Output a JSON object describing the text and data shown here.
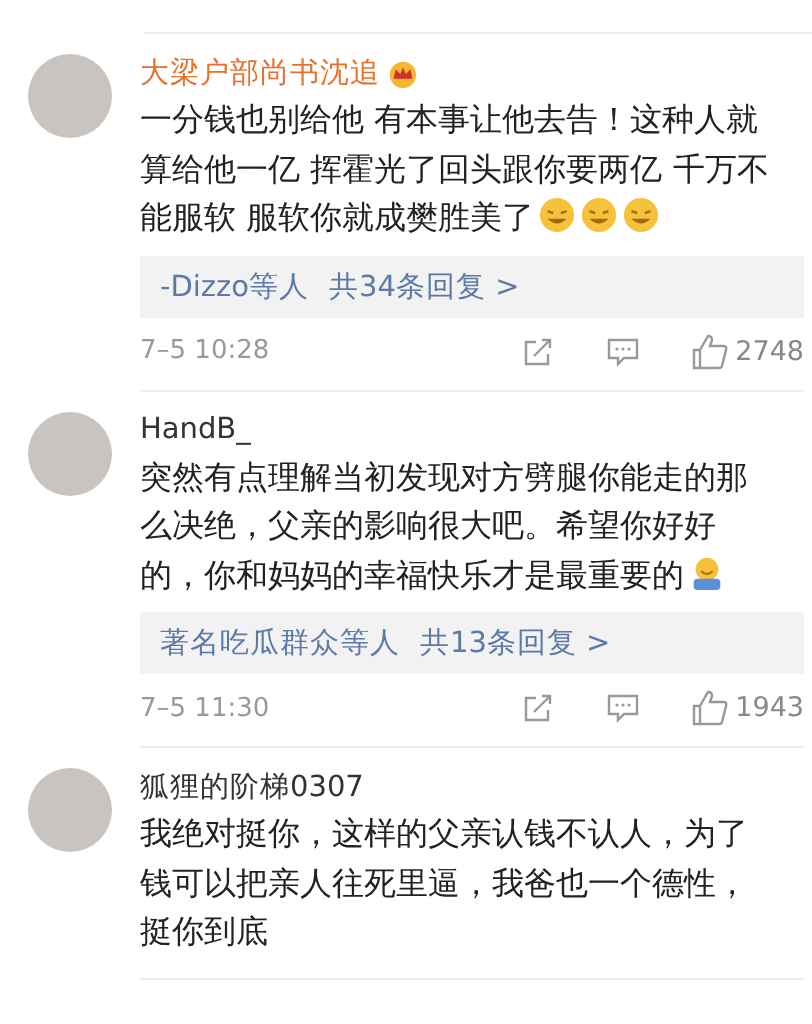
{
  "comments": [
    {
      "name": "大梁户部尚书沈追",
      "vip": true,
      "text": "一分钱也别给他 有本事让他去告！这种人就算给他一亿 挥霍光了回头跟你要两亿 千万不能服软 服软你就成樊胜美了",
      "emojis": [
        {
          "kind": "laugh"
        },
        {
          "kind": "laugh"
        },
        {
          "kind": "laugh"
        }
      ],
      "replies": {
        "who": "-Dizzo等人",
        "count": "共34条回复 >"
      },
      "time": "7–5 10:28",
      "likes": "2748"
    },
    {
      "name": "HandB_",
      "vip": false,
      "text": "突然有点理解当初发现对方劈腿你能走的那么决绝，父亲的影响很大吧。希望你好好的，你和妈妈的幸福快乐才是最重要的",
      "emojis": [
        {
          "kind": "hug"
        }
      ],
      "replies": {
        "who": "著名吃瓜群众等人",
        "count": "共13条回复 >"
      },
      "time": "7–5 11:30",
      "likes": "1943"
    },
    {
      "name": "狐狸的阶梯0307",
      "vip": false,
      "text": "我绝对挺你，这样的父亲认钱不认人，为了钱可以把亲人往死里逼，我爸也一个德性，挺你到底"
    }
  ]
}
